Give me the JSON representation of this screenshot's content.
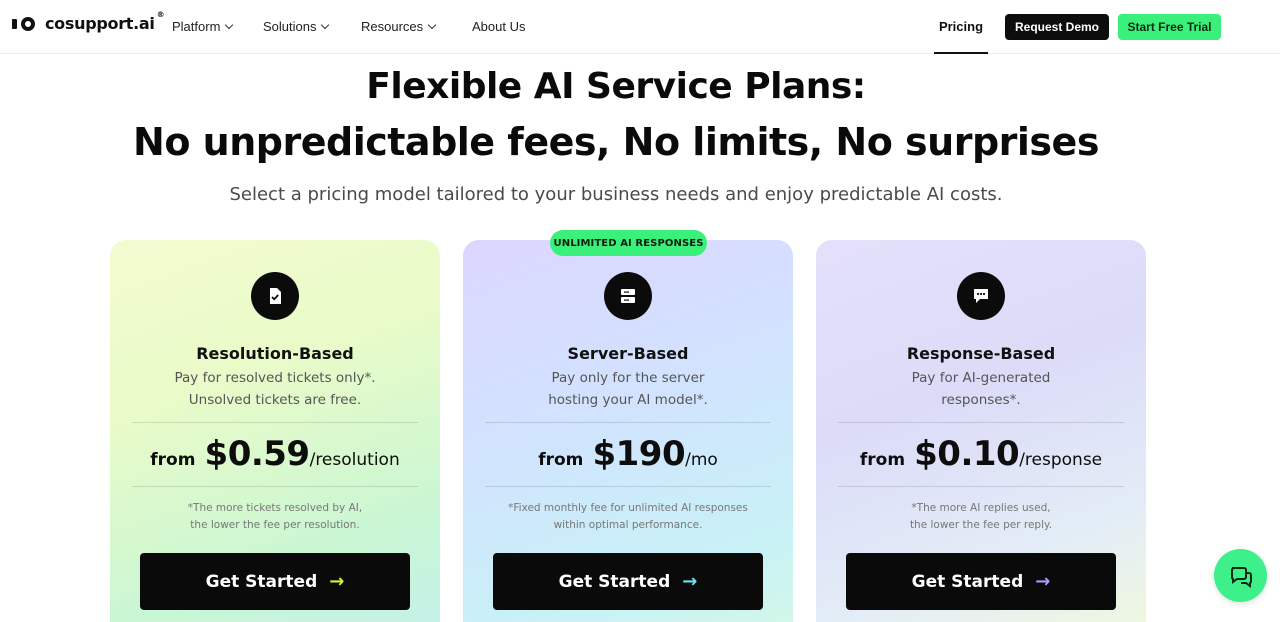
{
  "brand": {
    "name": "cosupport.ai",
    "registered": "®"
  },
  "nav": {
    "items": [
      {
        "label": "Platform",
        "has_dropdown": true
      },
      {
        "label": "Solutions",
        "has_dropdown": true
      },
      {
        "label": "Resources",
        "has_dropdown": true
      },
      {
        "label": "About Us",
        "has_dropdown": false
      }
    ],
    "pricing": "Pricing",
    "request_demo": "Request Demo",
    "start_trial": "Start Free Trial"
  },
  "hero": {
    "title_line1": "Flexible AI Service Plans:",
    "title_line2": "No unpredictable fees, No limits, No surprises",
    "subtitle": "Select a pricing model tailored to your business needs and enjoy predictable AI costs."
  },
  "badge": "UNLIMITED AI RESPONSES",
  "plans": [
    {
      "icon": "document-check-icon",
      "title": "Resolution-Based",
      "desc_line1": "Pay for resolved tickets only*.",
      "desc_line2": "Unsolved tickets are free.",
      "from": "from",
      "amount": "$0.59",
      "unit": "/resolution",
      "note_line1": "*The more tickets resolved by AI,",
      "note_line2": "the lower the fee per resolution.",
      "cta": "Get Started",
      "arrow": "→",
      "arrow_color": "#d4f03a"
    },
    {
      "icon": "server-icon",
      "title": "Server-Based",
      "desc_line1": "Pay only for the server",
      "desc_line2": "hosting your AI model*.",
      "from": "from",
      "amount": "$190",
      "unit": "/mo",
      "note_line1": "*Fixed monthly fee for unlimited AI responses",
      "note_line2": "within optimal performance.",
      "cta": "Get Started",
      "arrow": "→",
      "arrow_color": "#6fe0f0"
    },
    {
      "icon": "chat-bubble-icon",
      "title": "Response-Based",
      "desc_line1": "Pay for AI-generated",
      "desc_line2": "responses*.",
      "from": "from",
      "amount": "$0.10",
      "unit": "/response",
      "note_line1": "*The more AI replies used,",
      "note_line2": "the lower the fee per reply.",
      "cta": "Get Started",
      "arrow": "→",
      "arrow_color": "#a99bff"
    }
  ],
  "colors": {
    "accent_green": "#3bf07a",
    "dark": "#0a0a0a"
  },
  "chat_widget": {
    "icon": "chat-icon"
  }
}
